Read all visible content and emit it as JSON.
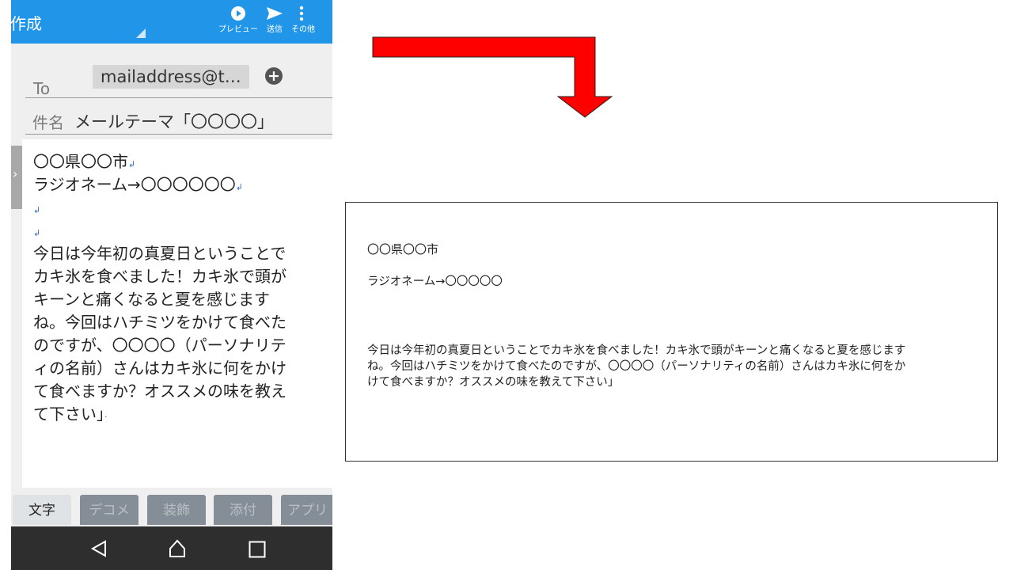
{
  "app_bar": {
    "title": "作成",
    "actions": [
      {
        "label": "プレビュー",
        "icon": "play-circle-icon"
      },
      {
        "label": "送信",
        "icon": "send-icon"
      },
      {
        "label": "その他",
        "icon": "more-vert-icon"
      }
    ]
  },
  "compose": {
    "to_label": "To",
    "to_chip": "mailaddress@t…",
    "add_recipient_icon": "plus-circle-icon",
    "subject_label": "件名",
    "subject_value": "メールテーマ「〇〇〇〇」",
    "side_tab_icon": "chevron-right-icon",
    "body_lines": [
      {
        "text": "〇〇県〇〇市",
        "ret": "↲"
      },
      {
        "text": "ラジオネーム→〇〇〇〇〇〇",
        "ret": "↲"
      },
      {
        "text": "",
        "ret": "↲"
      },
      {
        "text": "",
        "ret": "↲"
      },
      {
        "text": "今日は今年初の真夏日ということで",
        "ret": ""
      },
      {
        "text": "カキ氷を食べました！カキ氷で頭が",
        "ret": ""
      },
      {
        "text": "キーンと痛くなると夏を感じます",
        "ret": ""
      },
      {
        "text": "ね。今回はハチミツをかけて食べた",
        "ret": ""
      },
      {
        "text": "のですが、〇〇〇〇（パーソナリテ",
        "ret": ""
      },
      {
        "text": "ィの名前）さんはカキ氷に何をかけ",
        "ret": ""
      },
      {
        "text": "て食べますか？オススメの味を教え",
        "ret": ""
      },
      {
        "text": "て下さい」",
        "ret": "·"
      }
    ]
  },
  "bottom_tabs": [
    {
      "label": "文字",
      "active": true
    },
    {
      "label": "デコメ",
      "active": false
    },
    {
      "label": "装飾",
      "active": false
    },
    {
      "label": "添付",
      "active": false
    },
    {
      "label": "アプリ",
      "active": false
    }
  ],
  "nav_bar": {
    "back_icon": "back-triangle-icon",
    "home_icon": "home-icon",
    "recents_icon": "recents-square-icon"
  },
  "arrow": {
    "color": "#ff0000",
    "direction": "right-then-down"
  },
  "result": {
    "line1": "〇〇県〇〇市",
    "line2": "ラジオネーム→〇〇〇〇〇",
    "paragraph_lines": [
      "今日は今年初の真夏日ということでカキ氷を食べました！カキ氷で頭がキーンと痛くなると夏を感じます",
      "ね。今回はハチミツをかけて食べたのですが、〇〇〇〇（パーソナリティの名前）さんはカキ氷に何をか",
      "けて食べますか？オススメの味を教えて下さい」"
    ]
  },
  "colors": {
    "app_bar": "#2196e8",
    "arrow": "#ff0000",
    "nav_bar": "#2e2e2e"
  }
}
